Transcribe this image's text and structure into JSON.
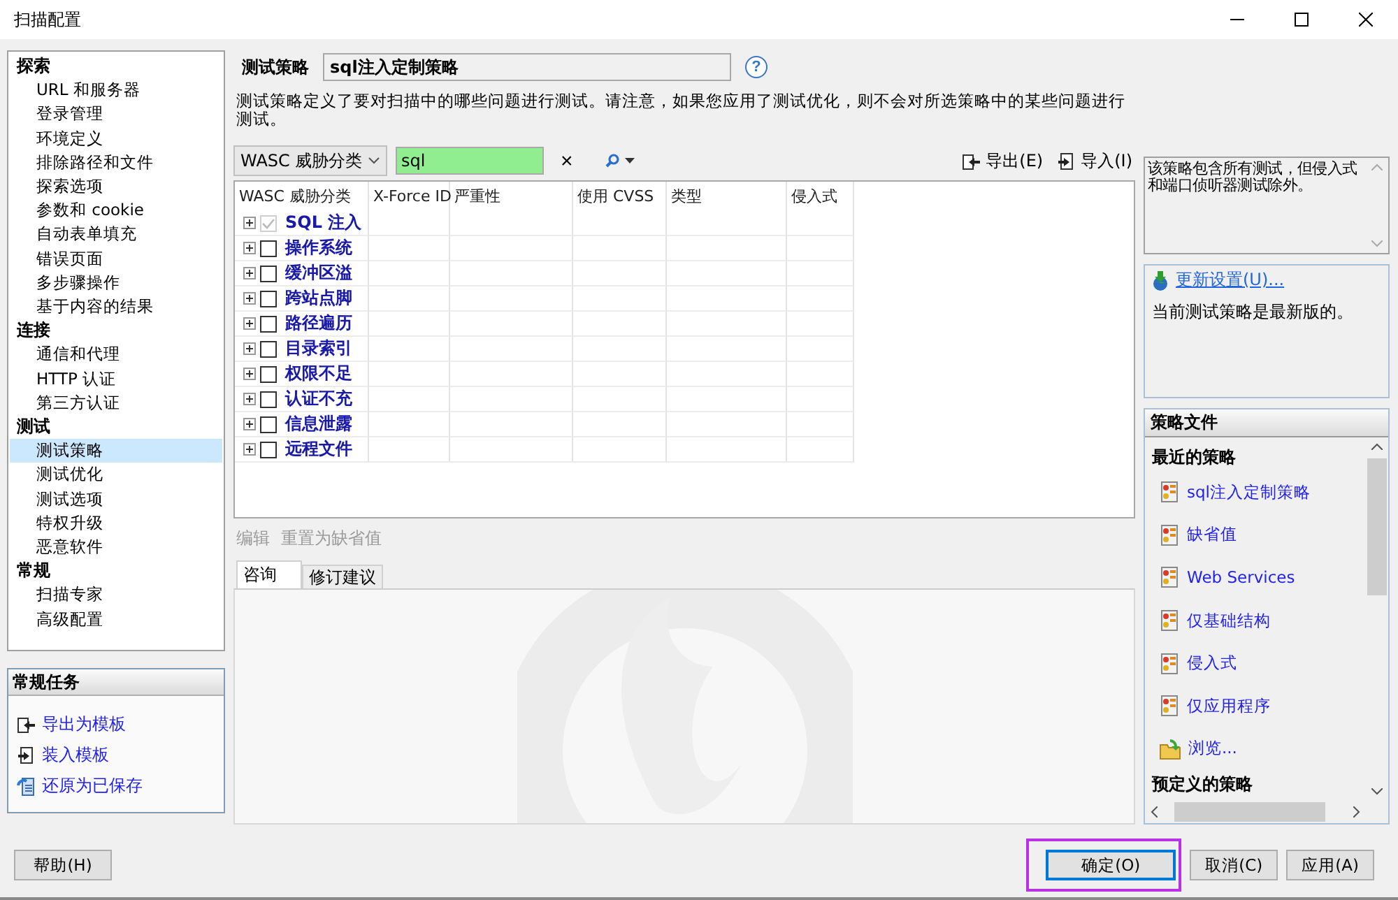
{
  "window": {
    "title": "扫描配置"
  },
  "sidebar": {
    "groups": [
      {
        "label": "探索",
        "children": [
          {
            "label": "URL 和服务器",
            "selected": false
          },
          {
            "label": "登录管理",
            "selected": false
          },
          {
            "label": "环境定义",
            "selected": false
          },
          {
            "label": "排除路径和文件",
            "selected": false
          },
          {
            "label": "探索选项",
            "selected": false
          },
          {
            "label": "参数和 cookie",
            "selected": false
          },
          {
            "label": "自动表单填充",
            "selected": false
          },
          {
            "label": "错误页面",
            "selected": false
          },
          {
            "label": "多步骤操作",
            "selected": false
          },
          {
            "label": "基于内容的结果",
            "selected": false
          }
        ]
      },
      {
        "label": "连接",
        "children": [
          {
            "label": "通信和代理",
            "selected": false
          },
          {
            "label": "HTTP 认证",
            "selected": false
          },
          {
            "label": "第三方认证",
            "selected": false
          }
        ]
      },
      {
        "label": "测试",
        "children": [
          {
            "label": "测试策略",
            "selected": true
          },
          {
            "label": "测试优化",
            "selected": false
          },
          {
            "label": "测试选项",
            "selected": false
          },
          {
            "label": "特权升级",
            "selected": false
          },
          {
            "label": "恶意软件",
            "selected": false
          }
        ]
      },
      {
        "label": "常规",
        "children": [
          {
            "label": "扫描专家",
            "selected": false
          },
          {
            "label": "高级配置",
            "selected": false
          }
        ]
      }
    ]
  },
  "tasks": {
    "title": "常规任务",
    "items": [
      {
        "label": "导出为模板",
        "kind": "export"
      },
      {
        "label": "装入模板",
        "kind": "import"
      },
      {
        "label": "还原为已保存",
        "kind": "restore"
      }
    ]
  },
  "policy": {
    "label": "测试策略",
    "value": "sql注入定制策略",
    "help": "?"
  },
  "description": "测试策略定义了要对扫描中的哪些问题进行测试。请注意，如果您应用了测试优化，则不会对所选策略中的某些问题进行测试。",
  "toolbar": {
    "grouping": "WASC 威胁分类",
    "search": "sql",
    "clear": "×",
    "export": "导出(E)",
    "import": "导入(I)"
  },
  "table": {
    "columns": [
      "WASC 威胁分类",
      "X-Force ID",
      "严重性",
      "使用 CVSS",
      "类型",
      "侵入式"
    ],
    "rows": [
      {
        "name": "SQL 注入",
        "checked": true,
        "disabled": true
      },
      {
        "name": "操作系统",
        "checked": false,
        "disabled": false
      },
      {
        "name": "缓冲区溢",
        "checked": false,
        "disabled": false
      },
      {
        "name": "跨站点脚",
        "checked": false,
        "disabled": false
      },
      {
        "name": "路径遍历",
        "checked": false,
        "disabled": false
      },
      {
        "name": "目录索引",
        "checked": false,
        "disabled": false
      },
      {
        "name": "权限不足",
        "checked": false,
        "disabled": false
      },
      {
        "name": "认证不充",
        "checked": false,
        "disabled": false
      },
      {
        "name": "信息泄露",
        "checked": false,
        "disabled": false
      },
      {
        "name": "远程文件",
        "checked": false,
        "disabled": false
      }
    ]
  },
  "actions": [
    {
      "label": "编辑",
      "disabled": true
    },
    {
      "label": "重置为缺省值",
      "disabled": true
    }
  ],
  "tabs": [
    {
      "label": "咨询",
      "selected": true
    },
    {
      "label": "修订建议",
      "selected": false
    }
  ],
  "policy_summary": "该策略包含所有测试，但侵入式和端口侦听器测试除外。",
  "update": {
    "link": "更新设置(U)...",
    "status": "当前测试策略是最新版的。"
  },
  "policy_files": {
    "title": "策略文件",
    "sections": [
      {
        "heading": "最近的策略",
        "items": [
          {
            "label": "sql注入定制策略",
            "kind": "policy"
          },
          {
            "label": "缺省值",
            "kind": "policy"
          },
          {
            "label": "Web Services",
            "kind": "policy"
          },
          {
            "label": "仅基础结构",
            "kind": "policy"
          },
          {
            "label": "侵入式",
            "kind": "policy"
          },
          {
            "label": "仅应用程序",
            "kind": "policy"
          },
          {
            "label": "浏览...",
            "kind": "browse"
          }
        ]
      },
      {
        "heading": "预定义的策略"
      }
    ]
  },
  "footer": {
    "help": "帮助(H)",
    "buttons": [
      {
        "label": "确定(O)",
        "default": true,
        "highlighted": true
      },
      {
        "label": "取消(C)",
        "default": false,
        "highlighted": false
      },
      {
        "label": "应用(A)",
        "default": false,
        "highlighted": false
      }
    ]
  }
}
